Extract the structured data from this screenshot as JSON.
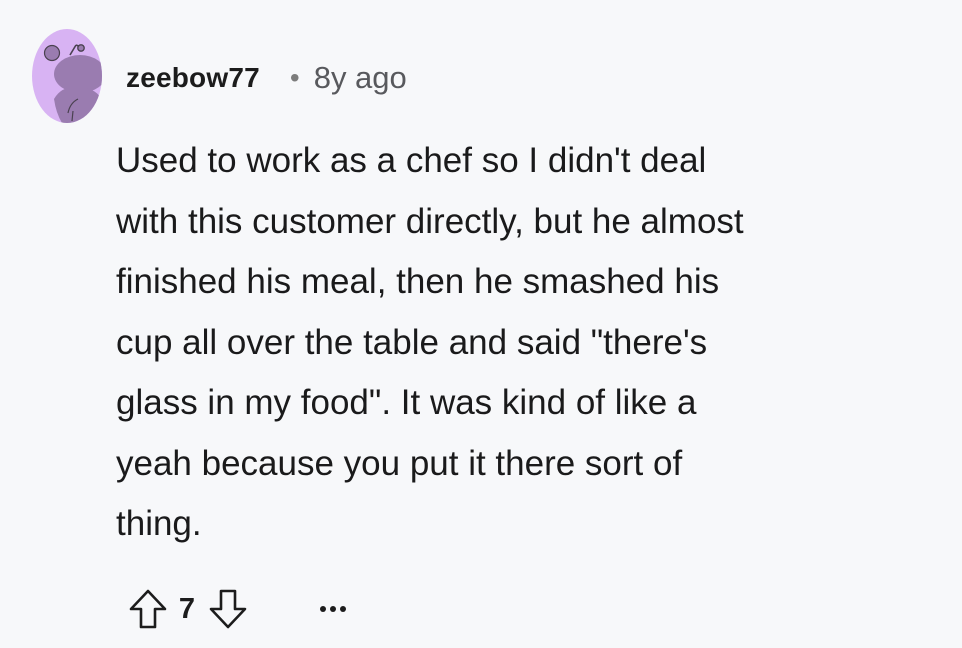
{
  "comment": {
    "author": "zeebow77",
    "separator": "•",
    "age": "8y ago",
    "text": "Used to work as a chef so I didn't deal\nwith this customer directly, but he almost\nfinished his meal, then he smashed his\ncup all over the table and said \"there's\nglass in my food\". It was kind of like a\nyeah because you put it there sort of\nthing.",
    "score": "7"
  },
  "icons": {
    "avatar": "snoo-avatar-icon",
    "upvote": "upvote-arrow-icon",
    "downvote": "downvote-arrow-icon",
    "more": "more-options-icon"
  },
  "colors": {
    "background": "#f7f8fa",
    "avatar_bg": "#d8b3f3",
    "avatar_figure": "#9a7cb0",
    "text": "#1a1a1b",
    "meta": "#58595d"
  }
}
